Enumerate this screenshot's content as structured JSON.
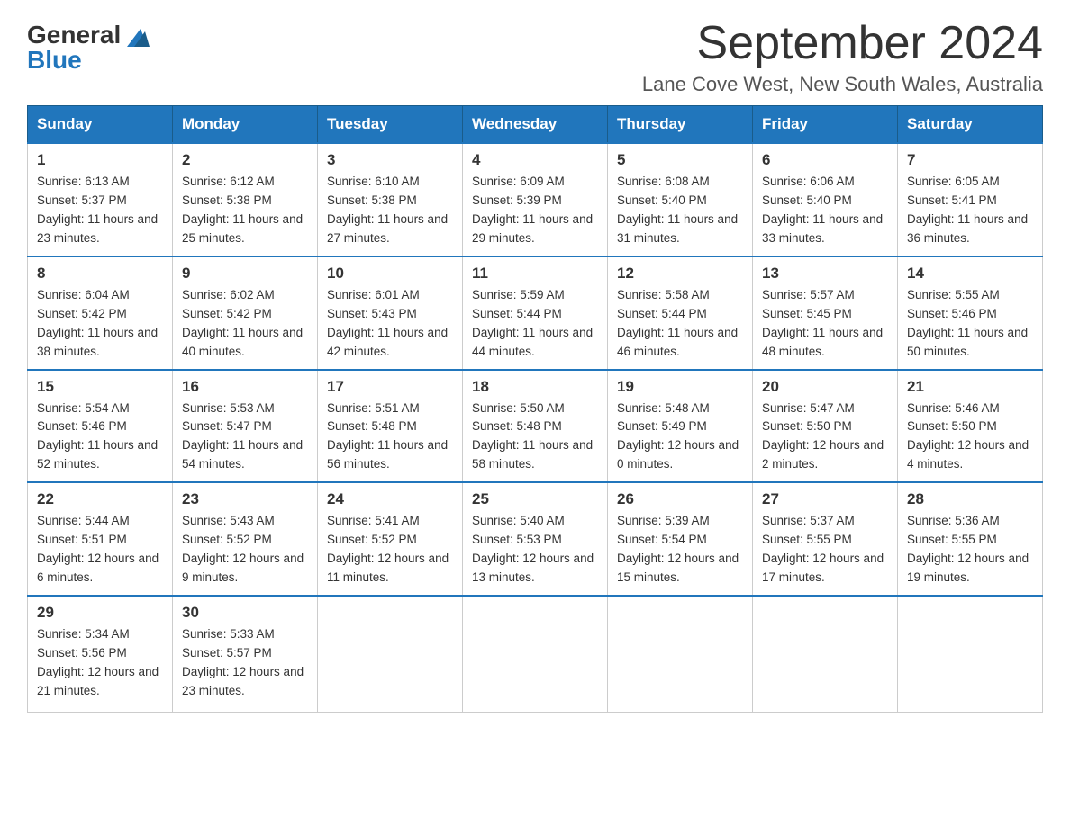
{
  "logo": {
    "general": "General",
    "blue": "Blue"
  },
  "header": {
    "title": "September 2024",
    "subtitle": "Lane Cove West, New South Wales, Australia"
  },
  "weekdays": [
    "Sunday",
    "Monday",
    "Tuesday",
    "Wednesday",
    "Thursday",
    "Friday",
    "Saturday"
  ],
  "weeks": [
    [
      {
        "day": "1",
        "sunrise": "6:13 AM",
        "sunset": "5:37 PM",
        "daylight": "11 hours and 23 minutes."
      },
      {
        "day": "2",
        "sunrise": "6:12 AM",
        "sunset": "5:38 PM",
        "daylight": "11 hours and 25 minutes."
      },
      {
        "day": "3",
        "sunrise": "6:10 AM",
        "sunset": "5:38 PM",
        "daylight": "11 hours and 27 minutes."
      },
      {
        "day": "4",
        "sunrise": "6:09 AM",
        "sunset": "5:39 PM",
        "daylight": "11 hours and 29 minutes."
      },
      {
        "day": "5",
        "sunrise": "6:08 AM",
        "sunset": "5:40 PM",
        "daylight": "11 hours and 31 minutes."
      },
      {
        "day": "6",
        "sunrise": "6:06 AM",
        "sunset": "5:40 PM",
        "daylight": "11 hours and 33 minutes."
      },
      {
        "day": "7",
        "sunrise": "6:05 AM",
        "sunset": "5:41 PM",
        "daylight": "11 hours and 36 minutes."
      }
    ],
    [
      {
        "day": "8",
        "sunrise": "6:04 AM",
        "sunset": "5:42 PM",
        "daylight": "11 hours and 38 minutes."
      },
      {
        "day": "9",
        "sunrise": "6:02 AM",
        "sunset": "5:42 PM",
        "daylight": "11 hours and 40 minutes."
      },
      {
        "day": "10",
        "sunrise": "6:01 AM",
        "sunset": "5:43 PM",
        "daylight": "11 hours and 42 minutes."
      },
      {
        "day": "11",
        "sunrise": "5:59 AM",
        "sunset": "5:44 PM",
        "daylight": "11 hours and 44 minutes."
      },
      {
        "day": "12",
        "sunrise": "5:58 AM",
        "sunset": "5:44 PM",
        "daylight": "11 hours and 46 minutes."
      },
      {
        "day": "13",
        "sunrise": "5:57 AM",
        "sunset": "5:45 PM",
        "daylight": "11 hours and 48 minutes."
      },
      {
        "day": "14",
        "sunrise": "5:55 AM",
        "sunset": "5:46 PM",
        "daylight": "11 hours and 50 minutes."
      }
    ],
    [
      {
        "day": "15",
        "sunrise": "5:54 AM",
        "sunset": "5:46 PM",
        "daylight": "11 hours and 52 minutes."
      },
      {
        "day": "16",
        "sunrise": "5:53 AM",
        "sunset": "5:47 PM",
        "daylight": "11 hours and 54 minutes."
      },
      {
        "day": "17",
        "sunrise": "5:51 AM",
        "sunset": "5:48 PM",
        "daylight": "11 hours and 56 minutes."
      },
      {
        "day": "18",
        "sunrise": "5:50 AM",
        "sunset": "5:48 PM",
        "daylight": "11 hours and 58 minutes."
      },
      {
        "day": "19",
        "sunrise": "5:48 AM",
        "sunset": "5:49 PM",
        "daylight": "12 hours and 0 minutes."
      },
      {
        "day": "20",
        "sunrise": "5:47 AM",
        "sunset": "5:50 PM",
        "daylight": "12 hours and 2 minutes."
      },
      {
        "day": "21",
        "sunrise": "5:46 AM",
        "sunset": "5:50 PM",
        "daylight": "12 hours and 4 minutes."
      }
    ],
    [
      {
        "day": "22",
        "sunrise": "5:44 AM",
        "sunset": "5:51 PM",
        "daylight": "12 hours and 6 minutes."
      },
      {
        "day": "23",
        "sunrise": "5:43 AM",
        "sunset": "5:52 PM",
        "daylight": "12 hours and 9 minutes."
      },
      {
        "day": "24",
        "sunrise": "5:41 AM",
        "sunset": "5:52 PM",
        "daylight": "12 hours and 11 minutes."
      },
      {
        "day": "25",
        "sunrise": "5:40 AM",
        "sunset": "5:53 PM",
        "daylight": "12 hours and 13 minutes."
      },
      {
        "day": "26",
        "sunrise": "5:39 AM",
        "sunset": "5:54 PM",
        "daylight": "12 hours and 15 minutes."
      },
      {
        "day": "27",
        "sunrise": "5:37 AM",
        "sunset": "5:55 PM",
        "daylight": "12 hours and 17 minutes."
      },
      {
        "day": "28",
        "sunrise": "5:36 AM",
        "sunset": "5:55 PM",
        "daylight": "12 hours and 19 minutes."
      }
    ],
    [
      {
        "day": "29",
        "sunrise": "5:34 AM",
        "sunset": "5:56 PM",
        "daylight": "12 hours and 21 minutes."
      },
      {
        "day": "30",
        "sunrise": "5:33 AM",
        "sunset": "5:57 PM",
        "daylight": "12 hours and 23 minutes."
      },
      null,
      null,
      null,
      null,
      null
    ]
  ]
}
